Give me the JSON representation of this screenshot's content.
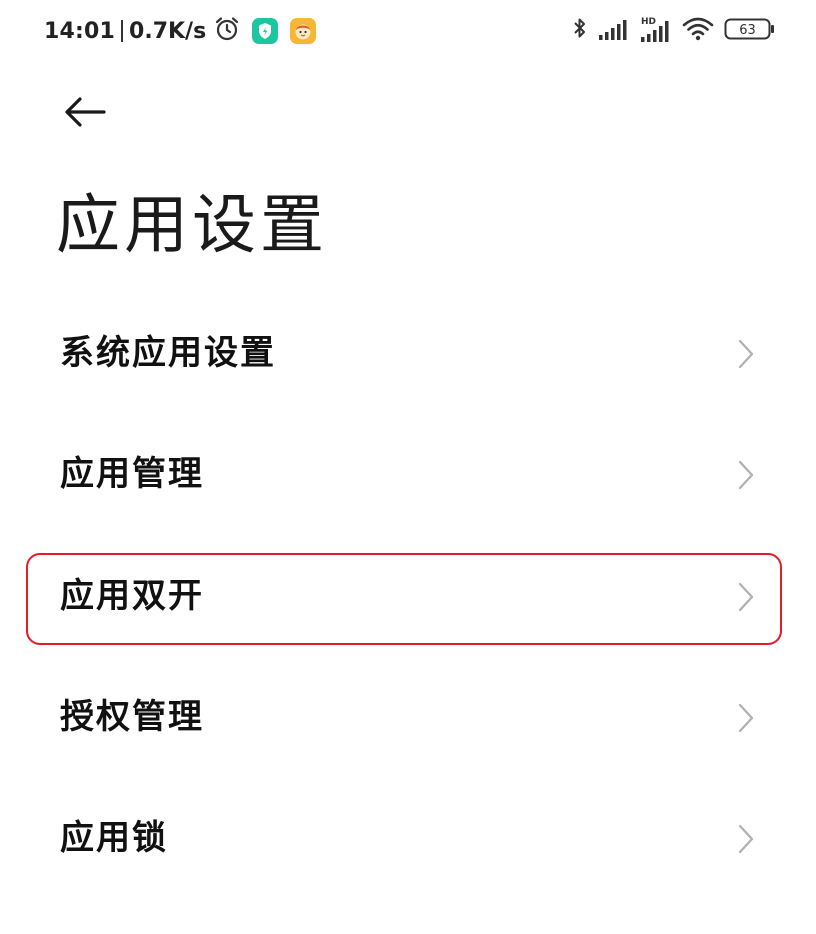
{
  "status_bar": {
    "time": "14:01",
    "net_speed": "0.7K/s",
    "battery_level": "63",
    "icons": [
      "alarm-icon",
      "security-app-icon",
      "app-notification-icon",
      "bluetooth-icon",
      "signal-icon",
      "hd-signal-icon",
      "wifi-icon",
      "battery-icon"
    ]
  },
  "header": {
    "back_icon": "arrow-left-icon",
    "title": "应用设置"
  },
  "list": {
    "items": [
      {
        "label": "系统应用设置",
        "icon": "chevron-right-icon"
      },
      {
        "label": "应用管理",
        "icon": "chevron-right-icon"
      },
      {
        "label": "应用双开",
        "icon": "chevron-right-icon",
        "highlighted": true
      },
      {
        "label": "授权管理",
        "icon": "chevron-right-icon"
      },
      {
        "label": "应用锁",
        "icon": "chevron-right-icon"
      }
    ]
  },
  "colors": {
    "highlight_border": "#e31b2b",
    "chevron": "#b0b0b0",
    "text": "#111111"
  }
}
